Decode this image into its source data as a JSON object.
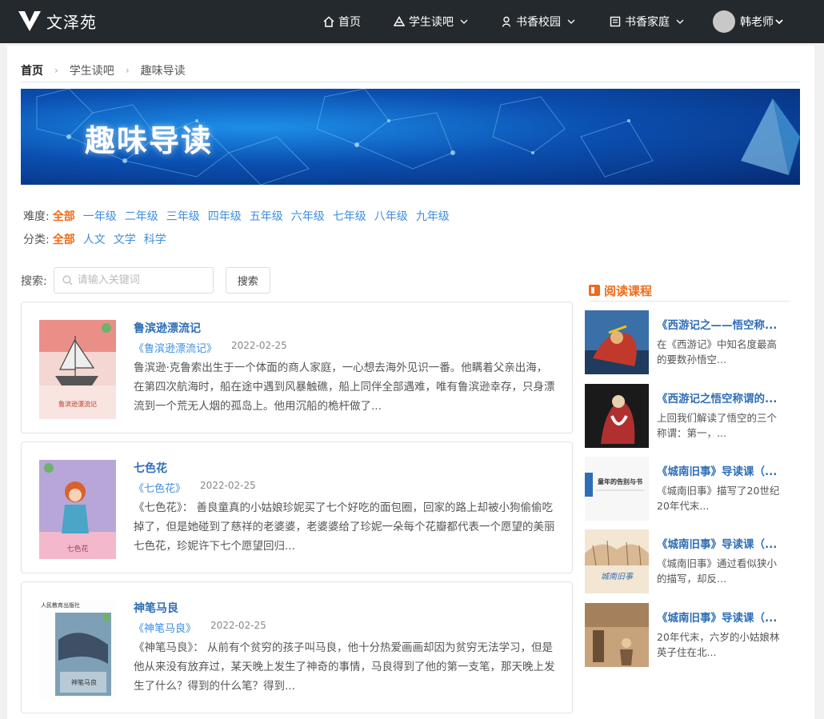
{
  "app": {
    "logo_text": "文泽苑"
  },
  "nav": {
    "home": "首页",
    "student_reading": "学生读吧",
    "campus": "书香校园",
    "family": "书香家庭",
    "user": "韩老师"
  },
  "breadcrumb": [
    "首页",
    "学生读吧",
    "趣味导读"
  ],
  "banner": {
    "title": "趣味导读"
  },
  "filters": {
    "difficulty_label": "难度:",
    "difficulty": [
      "全部",
      "一年级",
      "二年级",
      "三年级",
      "四年级",
      "五年级",
      "六年级",
      "七年级",
      "八年级",
      "九年级"
    ],
    "difficulty_active": "全部",
    "category_label": "分类:",
    "category": [
      "全部",
      "人文",
      "文学",
      "科学"
    ],
    "category_active": "全部"
  },
  "search": {
    "label": "搜索:",
    "placeholder": "请输入关键词",
    "button": "搜索"
  },
  "articles": [
    {
      "title": "鲁滨逊漂流记",
      "book": "《鲁滨逊漂流记》",
      "date": "2022-02-25",
      "desc": "鲁滨逊·克鲁索出生于一个体面的商人家庭，一心想去海外见识一番。他瞒着父亲出海，在第四次航海时，船在途中遇到风暴触礁，船上同伴全部遇难，唯有鲁滨逊幸存，只身漂流到一个荒无人烟的孤岛上。他用沉船的桅杆做了..."
    },
    {
      "title": "七色花",
      "book": "《七色花》",
      "date": "2022-02-25",
      "desc": "《七色花》： 善良童真的小姑娘珍妮买了七个好吃的面包圈，回家的路上却被小狗偷偷吃掉了，但是她碰到了慈祥的老婆婆，老婆婆给了珍妮一朵每个花瓣都代表一个愿望的美丽七色花，珍妮许下七个愿望回归..."
    },
    {
      "title": "神笔马良",
      "book": "《神笔马良》",
      "date": "2022-02-25",
      "desc": "《神笔马良》： 从前有个贫穷的孩子叫马良，他十分热爱画画却因为贫穷无法学习，但是他从来没有放弃过，某天晚上发生了神奇的事情，马良得到了他的第一支笔，那天晚上发生了什么？得到的什么笔？得到..."
    }
  ],
  "sidebar": {
    "heading": "阅读课程",
    "courses": [
      {
        "title": "《西游记之——悟空称...",
        "desc": "在《西游记》中知名度最高的要数孙悟空..."
      },
      {
        "title": "《西游记之悟空称谓的...",
        "desc": "上回我们解读了悟空的三个称谓：第一，..."
      },
      {
        "title": "《城南旧事》导读课（...",
        "desc": "《城南旧事》描写了20世纪20年代末..."
      },
      {
        "title": "《城南旧事》导读课（...",
        "desc": "《城南旧事》通过看似狭小的描写，却反..."
      },
      {
        "title": "《城南旧事》导读课（...",
        "desc": "20年代末，六岁的小姑娘林英子住在北..."
      }
    ]
  },
  "colors": {
    "accent_orange": "#ef6c1a",
    "link_blue": "#3d8ee0",
    "title_blue": "#2e6eb6",
    "topbar": "#24292e"
  },
  "cover_text": {
    "c1": "鲁滨逊漂流记",
    "c2": "七色花",
    "c3_top": "人民教育出版社",
    "c3": "神笔马良",
    "t3": "童年的告别与书",
    "t4": "城南旧事"
  }
}
